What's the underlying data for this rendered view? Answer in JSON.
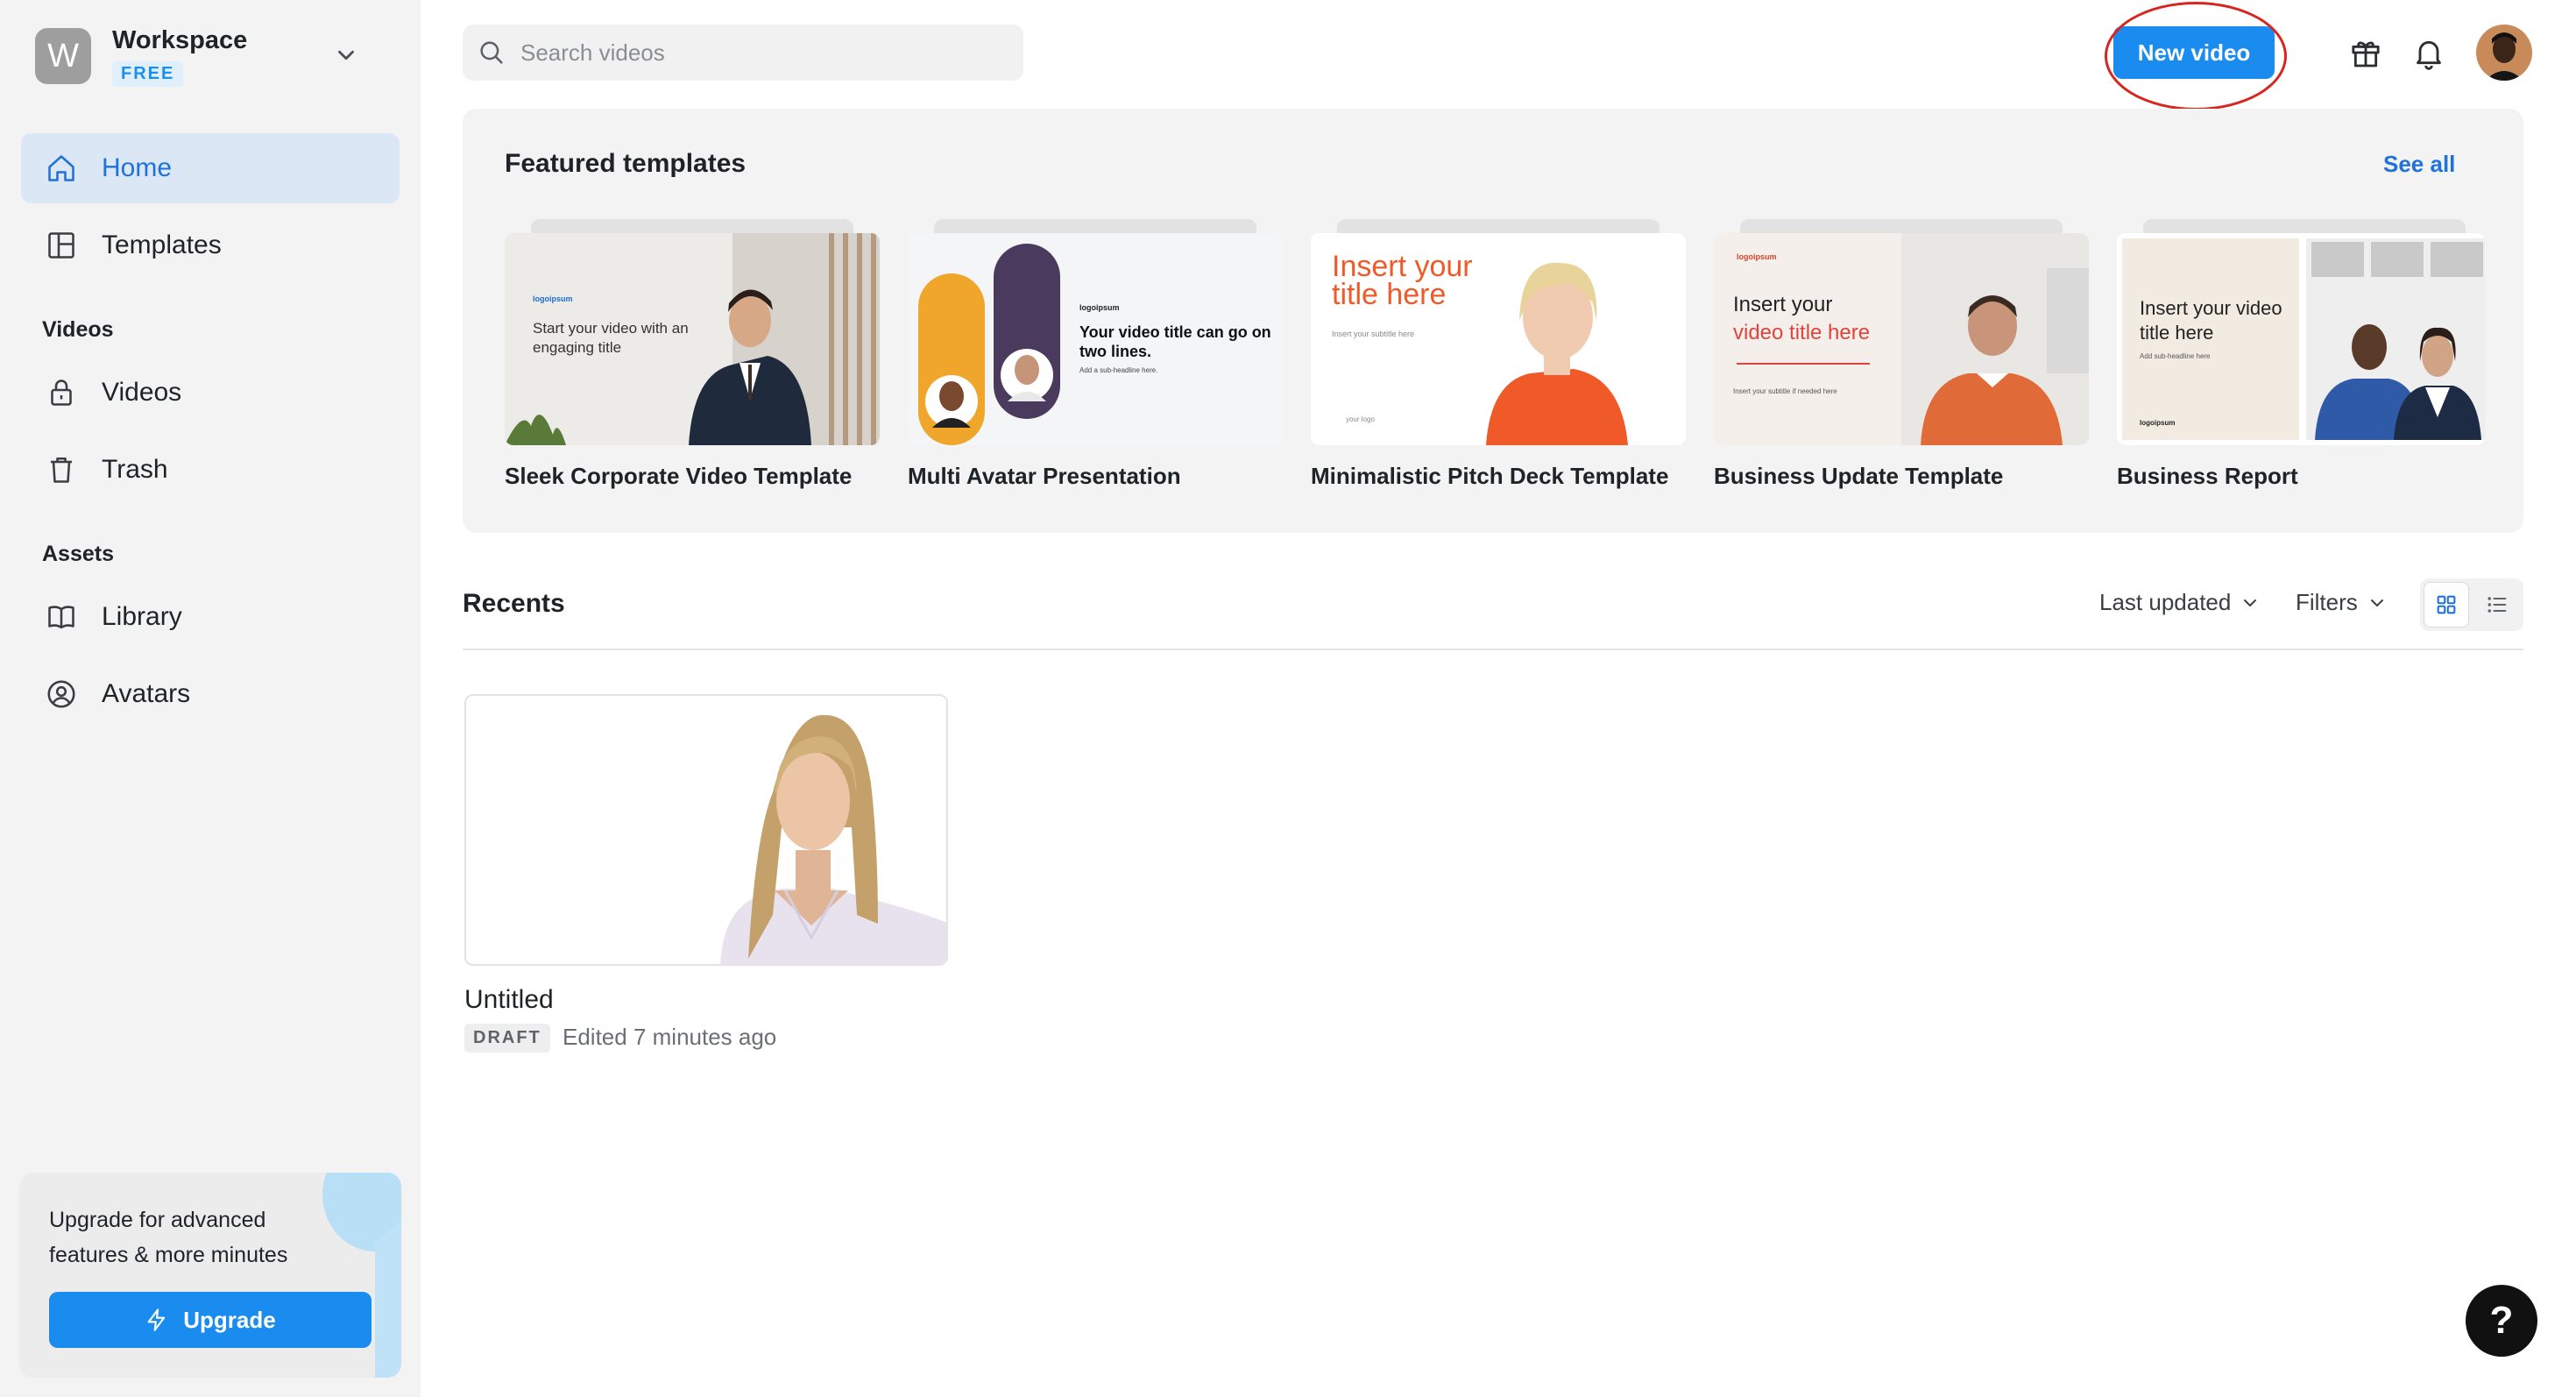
{
  "workspace": {
    "initial": "W",
    "name": "Workspace",
    "plan": "FREE"
  },
  "sidebar": {
    "items": [
      {
        "label": "Home",
        "icon": "home-icon",
        "active": true
      },
      {
        "label": "Templates",
        "icon": "templates-icon"
      },
      {
        "label": "Videos",
        "icon": "lock-icon"
      },
      {
        "label": "Trash",
        "icon": "trash-icon"
      },
      {
        "label": "Library",
        "icon": "book-icon"
      },
      {
        "label": "Avatars",
        "icon": "user-circle-icon"
      }
    ],
    "sections": {
      "videos": "Videos",
      "assets": "Assets"
    }
  },
  "upgrade": {
    "text": "Upgrade for advanced features & more minutes",
    "button": "Upgrade"
  },
  "search": {
    "placeholder": "Search videos"
  },
  "header": {
    "new_video": "New video"
  },
  "featured": {
    "title": "Featured templates",
    "see_all": "See all",
    "templates": [
      {
        "name": "Sleek Corporate Video Template",
        "logo": "logoipsum",
        "title": "Start your video with an engaging title"
      },
      {
        "name": "Multi Avatar Presentation",
        "logo": "logoipsum",
        "title": "Your video title can go on two lines.",
        "subtitle": "Add a sub-headline here."
      },
      {
        "name": "Minimalistic Pitch Deck Template",
        "title": "Insert your title here",
        "subtitle": "Insert your subtitle here",
        "logo": "your logo"
      },
      {
        "name": "Business Update Template",
        "logo": "logoipsum",
        "title_line1": "Insert your",
        "title_line2": "video title here",
        "subtitle": "Insert your subtitle if needed here"
      },
      {
        "name": "Business Report",
        "title": "Insert your video title here",
        "subtitle": "Add sub-headline here",
        "logo": "logoipsum"
      }
    ]
  },
  "recents": {
    "title": "Recents",
    "sort": "Last updated",
    "filters": "Filters",
    "videos": [
      {
        "title": "Untitled",
        "status": "DRAFT",
        "edited": "Edited 7 minutes ago"
      }
    ]
  },
  "help": {
    "label": "?"
  },
  "colors": {
    "accent": "#1a8cf0",
    "sidebar_bg": "#f3f3f4",
    "active_bg": "#dce7f6",
    "highlight_ring": "#d7261e"
  }
}
